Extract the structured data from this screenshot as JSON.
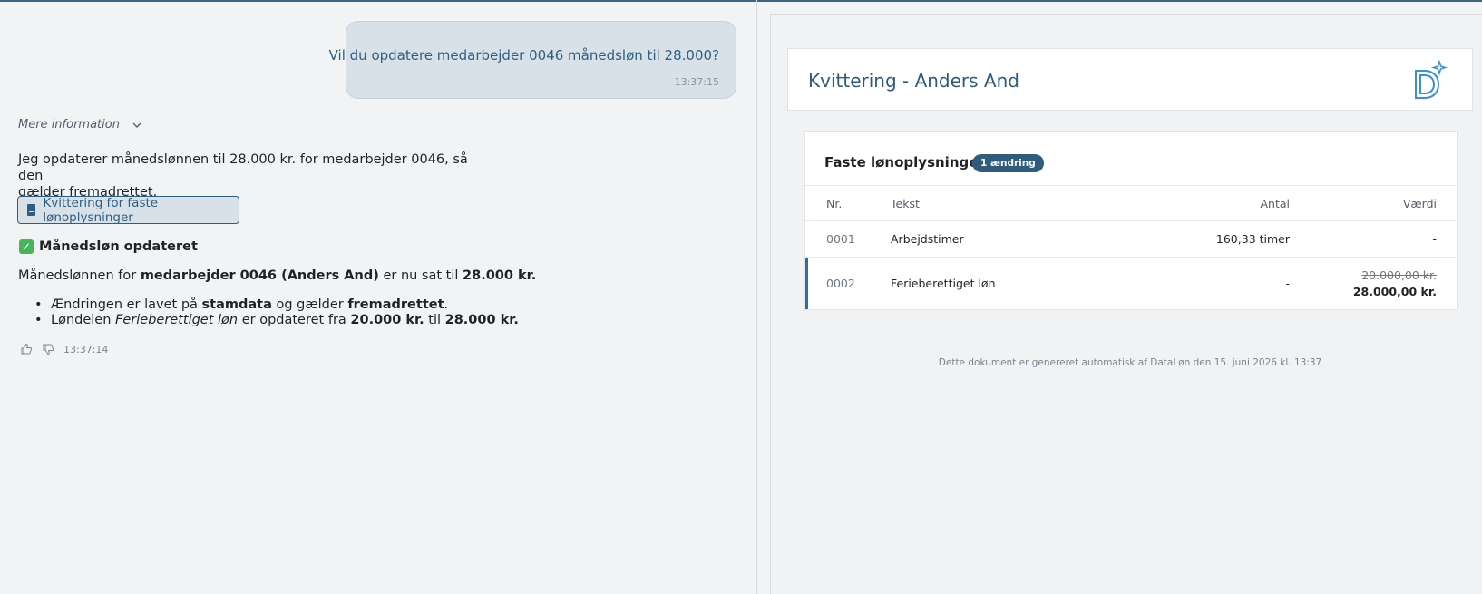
{
  "chat": {
    "user_message": "Vil du opdatere medarbejder 0046 månedsløn til 28.000?",
    "user_time": "13:37:15",
    "more_info_label": "Mere information",
    "answer_line1": "Jeg opdaterer månedslønnen til 28.000 kr. for medarbejder 0046, så den",
    "answer_line2": "gælder fremadrettet.",
    "receipt_button_label": "Kvittering for faste lønoplysninger",
    "status_title": "Månedsløn opdateret",
    "summary_prefix": "Månedslønnen for ",
    "summary_bold1": "medarbejder 0046 (Anders And)",
    "summary_mid": " er nu sat til ",
    "summary_bold2": "28.000 kr.",
    "bullet1_a": "Ændringen er lavet på ",
    "bullet1_b": "stamdata",
    "bullet1_c": " og gælder ",
    "bullet1_d": "fremadrettet",
    "bullet1_e": ".",
    "bullet2_a": "Løndelen ",
    "bullet2_b": "Ferieberettiget løn",
    "bullet2_c": " er opdateret fra ",
    "bullet2_d": "20.000 kr.",
    "bullet2_e": " til ",
    "bullet2_f": "28.000 kr.",
    "answer_time": "13:37:14"
  },
  "receipt": {
    "title": "Kvittering - Anders And",
    "section_title": "Faste lønoplysninger",
    "badge": "1 ændring",
    "columns": {
      "nr": "Nr.",
      "tekst": "Tekst",
      "antal": "Antal",
      "vaerdi": "Værdi"
    },
    "rows": [
      {
        "nr": "0001",
        "tekst": "Arbejdstimer",
        "antal": "160,33 timer",
        "vaerdi": "-"
      },
      {
        "nr": "0002",
        "tekst": "Ferieberettiget løn",
        "antal": "-",
        "vaerdi_old": "20.000,00 kr.",
        "vaerdi_new": "28.000,00 kr."
      }
    ],
    "footer": "Dette dokument er genereret automatisk af DataLøn den 15. juni 2026 kl. 13:37"
  },
  "colors": {
    "accent": "#2f5b7c",
    "user_bubble": "#d8e1e8",
    "success": "#47b35a",
    "changed_row_marker": "#2f6ea0"
  }
}
